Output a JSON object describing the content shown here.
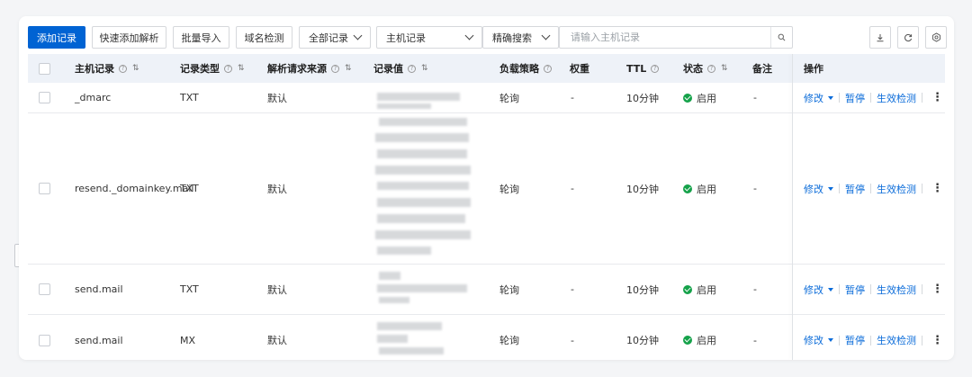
{
  "toolbar": {
    "add_record": "添加记录",
    "quick_add": "快速添加解析",
    "batch_import": "批量导入",
    "domain_check": "域名检测",
    "record_filter": "全部记录",
    "field_select": "主机记录",
    "match_mode": "精确搜索",
    "search_placeholder": "请输入主机记录"
  },
  "columns": {
    "host": "主机记录",
    "type": "记录类型",
    "source": "解析请求来源",
    "value": "记录值",
    "policy": "负载策略",
    "weight": "权重",
    "ttl": "TTL",
    "status": "状态",
    "remark": "备注",
    "ops": "操作"
  },
  "rows": [
    {
      "host": "_dmarc",
      "type": "TXT",
      "source": "默认",
      "policy": "轮询",
      "weight": "-",
      "ttl": "10分钟",
      "status": "启用",
      "remark": "-"
    },
    {
      "host": "resend._domainkey.mail",
      "type": "TXT",
      "source": "默认",
      "policy": "轮询",
      "weight": "-",
      "ttl": "10分钟",
      "status": "启用",
      "remark": "-"
    },
    {
      "host": "send.mail",
      "type": "TXT",
      "source": "默认",
      "policy": "轮询",
      "weight": "-",
      "ttl": "10分钟",
      "status": "启用",
      "remark": "-"
    },
    {
      "host": "send.mail",
      "type": "MX",
      "source": "默认",
      "policy": "轮询",
      "weight": "-",
      "ttl": "10分钟",
      "status": "启用",
      "remark": "-"
    }
  ],
  "actions": {
    "edit": "修改",
    "pause": "暂停",
    "verify": "生效检测",
    "more": "⋮"
  },
  "icons": {
    "help": "?",
    "sort": "⇅",
    "search": "search-icon",
    "download": "download-icon",
    "refresh": "refresh-icon",
    "settings": "gear-icon"
  },
  "colors": {
    "primary": "#0063d3",
    "link": "#0a6bd9",
    "status_ok": "#15a24a",
    "header_bg": "#eef2f8"
  }
}
